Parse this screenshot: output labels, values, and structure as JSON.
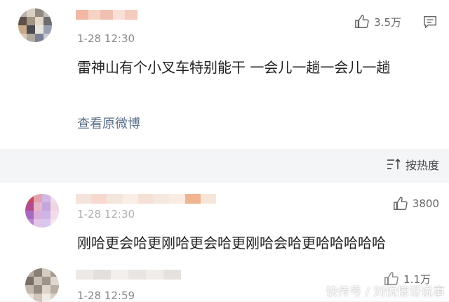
{
  "comments": [
    {
      "time": "1-28 12:30",
      "text": "雷神山有个小叉车特别能干 一会儿一趟一会儿一趟",
      "likes": "3.5万",
      "view_original": "查看原微博"
    },
    {
      "time": "1-28 12:30",
      "text": "刚哈更会哈更刚哈更会哈更刚哈会哈更哈哈哈哈哈",
      "likes": "3800"
    },
    {
      "time": "1-28 12:59",
      "likes": "1.1万"
    }
  ],
  "sort": {
    "label": "按热度",
    "icon": "sort-icon"
  },
  "icons": {
    "like": "thumbs-up-icon",
    "message": "comment-icon"
  },
  "watermark": "快传号 / 刘悦惊讶说事",
  "colors": {
    "link": "#5b6f8a",
    "background": "#f4f5f7",
    "text": "#222222",
    "meta": "#8a8a8a"
  }
}
